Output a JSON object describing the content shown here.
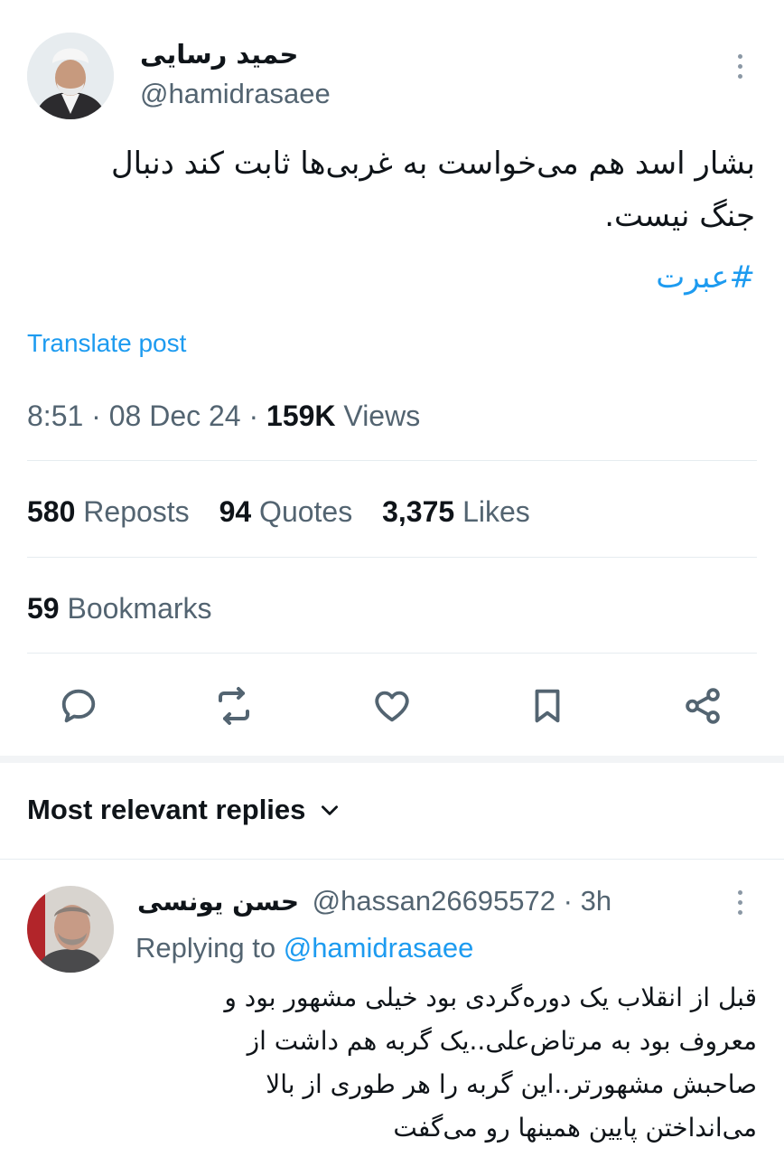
{
  "tweet": {
    "author_name": "حمید رسایی",
    "author_handle": "@hamidrasaee",
    "text_line1": "بشار اسد هم می‌خواست به غربی‌ها ثابت کند دنبال",
    "text_line2": "جنگ نیست.",
    "hashtag": "#عبرت",
    "translate_label": "Translate post",
    "time": "8:51",
    "date": "08 Dec 24",
    "views_count": "159K",
    "views_label": "Views",
    "reposts_count": "580",
    "reposts_label": "Reposts",
    "quotes_count": "94",
    "quotes_label": "Quotes",
    "likes_count": "3,375",
    "likes_label": "Likes",
    "bookmarks_count": "59",
    "bookmarks_label": "Bookmarks"
  },
  "actions": {
    "icons": [
      "reply-icon",
      "retweet-icon",
      "like-icon",
      "bookmark-icon",
      "share-icon"
    ]
  },
  "replies": {
    "header": "Most relevant replies",
    "items": [
      {
        "author_name": "حسن یونسی",
        "author_handle": "@hassan26695572",
        "time": "3h",
        "replying_prefix": "Replying to",
        "replying_handle": "@hamidrasaee",
        "lines": [
          "قبل از انقلاب یک دوره‌گردی بود خیلی مشهور بود و",
          "معروف بود به مرتاض‌علی..یک گربه هم داشت از",
          "صاحبش مشهورتر..این گربه را هر طوری از بالا",
          "می‌انداختن پایین همینها رو می‌گفت"
        ]
      }
    ]
  },
  "colors": {
    "accent": "#1d9bf0",
    "text": "#0f1419",
    "muted": "#536471",
    "divider": "#e6ecf0"
  }
}
